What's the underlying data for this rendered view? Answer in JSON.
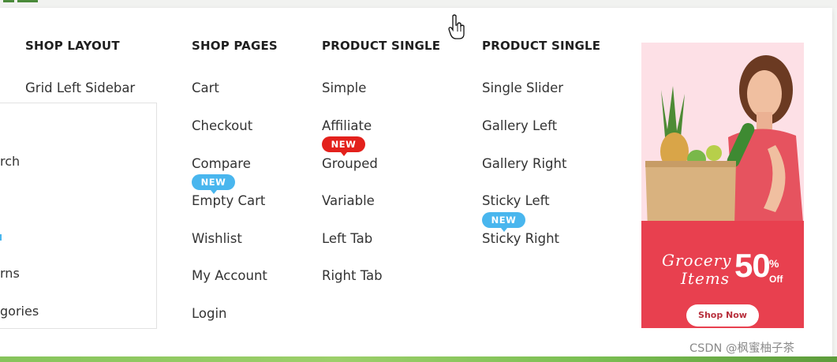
{
  "columns": [
    {
      "heading": "SHOP LAYOUT",
      "links": [
        "Grid Left Sidebar"
      ]
    },
    {
      "heading": "SHOP PAGES",
      "links": [
        "Cart",
        "Checkout",
        "Compare",
        "Empty Cart",
        "Wishlist",
        "My Account",
        "Login"
      ]
    },
    {
      "heading": "PRODUCT SINGLE",
      "links": [
        "Simple",
        "Affiliate",
        "Grouped",
        "Variable",
        "Left Tab",
        "Right Tab"
      ]
    },
    {
      "heading": "PRODUCT SINGLE",
      "links": [
        "Single Slider",
        "Gallery Left",
        "Gallery Right",
        "Sticky Left",
        "Sticky Right"
      ]
    }
  ],
  "badges": {
    "shop_pages_empty_cart": "NEW",
    "product_single_grouped": "NEW",
    "product_single_sticky_right": "NEW"
  },
  "left_dropdown": {
    "items": [
      "rch",
      "rns",
      "gories"
    ]
  },
  "promo": {
    "line1": "Grocery",
    "line2": "Items",
    "percent": "50",
    "percent_symbol": "%",
    "off": "Off",
    "button": "Shop Now"
  },
  "watermark": "CSDN @枫蜜柚子茶",
  "colors": {
    "badge_red": "#e3211c",
    "badge_blue": "#49b6ee",
    "promo_band": "#e8404f",
    "promo_bg": "#fde0e6"
  }
}
